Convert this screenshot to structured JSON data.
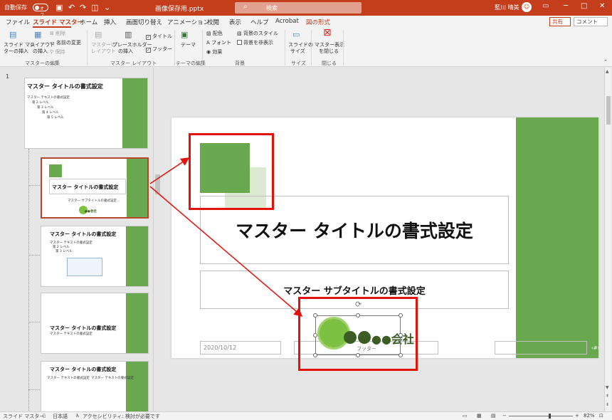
{
  "titlebar": {
    "autosave": "自動保存",
    "autosave_state": "オフ",
    "filename": "画像保存用.pptx",
    "search_placeholder": "検索",
    "user": "藍川 晴美"
  },
  "tabs": [
    "ファイル",
    "スライド マスター",
    "ホーム",
    "挿入",
    "画面切り替え",
    "アニメーション",
    "校閲",
    "表示",
    "ヘルプ",
    "Acrobat",
    "図の形式"
  ],
  "share_label": "共有",
  "comment_label": "コメント",
  "ribbon": {
    "insert_master_1": "スライド マス",
    "insert_master_2": "ターの挿入",
    "insert_layout_1": "レイアウト",
    "insert_layout_2": "の挿入",
    "delete": "削除",
    "rename": "名前の変更",
    "preserve": "保持",
    "group_master_edit": "マスターの編集",
    "master_layout_1": "マスターの",
    "master_layout_2": "レイアウト",
    "insert_placeholder_1": "プレースホルダー",
    "insert_placeholder_2": "の挿入",
    "title_check": "タイトル",
    "footer_check": "フッター",
    "group_master_layout": "マスター レイアウト",
    "themes": "テーマ",
    "group_edit_theme": "テーマの編集",
    "colors": "配色",
    "fonts": "フォント",
    "effects": "効果",
    "bg_styles": "背景のスタイル",
    "hide_bg": "背景を非表示",
    "group_background": "背景",
    "slide_size_1": "スライドの",
    "slide_size_2": "サイズ",
    "group_size": "サイズ",
    "close_master_1": "マスター表示",
    "close_master_2": "を閉じる",
    "group_close": "閉じる"
  },
  "thumbnails": {
    "slide_number": "1",
    "master_title": "マスター タイトルの書式設定",
    "master_text": "マスター テキストの書式設定",
    "level2": "第 2 レベル",
    "level3": "第 3 レベル",
    "level4": "第 4 レベル",
    "level5": "第 5 レベル",
    "layout_title": "マスター タイトルの書式設定",
    "layout_subtitle": "マスター サブタイトルの書式設定",
    "company": "●●会社"
  },
  "slide": {
    "title": "マスター タイトルの書式設定",
    "subtitle": "マスター サブタイトルの書式設定",
    "date": "2020/10/12",
    "logo_text": "●●会社",
    "footer": "フッター",
    "page_number": "‹#›"
  },
  "statusbar": {
    "view": "スライド マスター",
    "language": "日本語",
    "accessibility": "アクセシビリティ: 検討が必要です",
    "zoom": "82%"
  },
  "colors": {
    "accent": "#c43e1c",
    "slide_green": "#6aa84f",
    "highlight_red": "#e3120b"
  }
}
